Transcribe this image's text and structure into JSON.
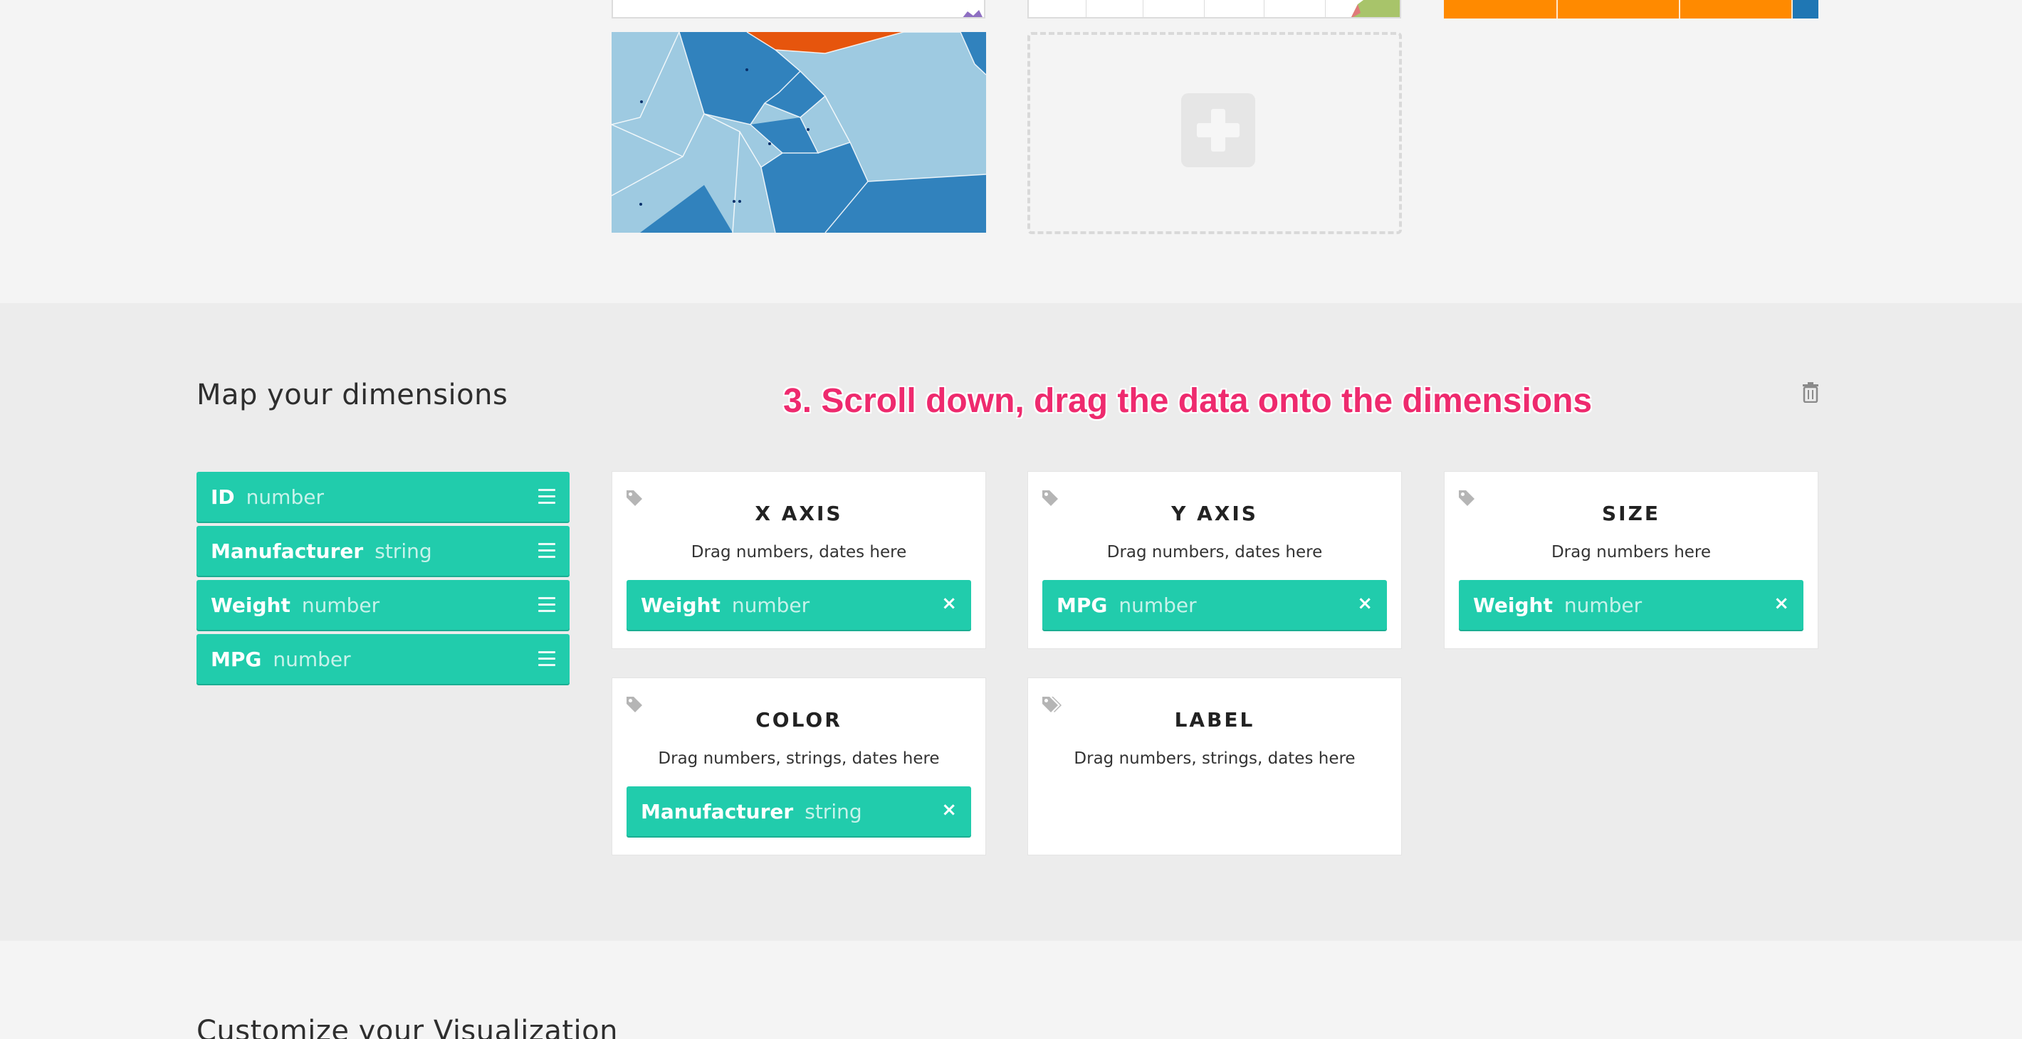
{
  "gallery": {
    "add_chart_icon": "plus-icon"
  },
  "dimensions": {
    "title": "Map your dimensions",
    "annotation": "3. Scroll down, drag the data onto the dimensions",
    "trash_icon": "trash-icon",
    "fields": [
      {
        "name": "ID",
        "type": "number"
      },
      {
        "name": "Manufacturer",
        "type": "string"
      },
      {
        "name": "Weight",
        "type": "number"
      },
      {
        "name": "MPG",
        "type": "number"
      }
    ],
    "slots": {
      "x_axis": {
        "title": "X AXIS",
        "hint": "Drag numbers, dates here",
        "value": {
          "name": "Weight",
          "type": "number"
        }
      },
      "y_axis": {
        "title": "Y AXIS",
        "hint": "Drag numbers, dates here",
        "value": {
          "name": "MPG",
          "type": "number"
        }
      },
      "size": {
        "title": "SIZE",
        "hint": "Drag numbers here",
        "value": {
          "name": "Weight",
          "type": "number"
        }
      },
      "color": {
        "title": "COLOR",
        "hint": "Drag numbers, strings, dates here",
        "value": {
          "name": "Manufacturer",
          "type": "string"
        }
      },
      "label": {
        "title": "LABEL",
        "hint": "Drag numbers, strings, dates here"
      }
    },
    "remove_glyph": "×"
  },
  "customize": {
    "title": "Customize your Visualization"
  },
  "colors": {
    "pill": "#21ccac",
    "annotation": "#ee2a6e",
    "section_bg": "#ececec"
  }
}
